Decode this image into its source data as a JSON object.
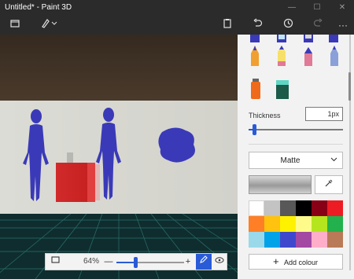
{
  "window": {
    "title": "Untitled* - Paint 3D",
    "minimize_glyph": "—",
    "maximize_glyph": "☐",
    "close_glyph": "✕"
  },
  "toolbar": {
    "menu_icon": "menu-folder-icon",
    "brushes_icon": "brushes-icon",
    "paste_icon": "paste-icon",
    "undo_icon": "undo-icon",
    "history_icon": "history-icon",
    "redo_icon": "redo-icon",
    "more_glyph": "···"
  },
  "zoom": {
    "percent": "64%",
    "level": 0.28,
    "minus": "—",
    "plus": "+"
  },
  "panel": {
    "thickness_label": "Thickness",
    "thickness_value": "1px",
    "thickness_level": 0.04,
    "finish": "Matte",
    "add_colour": "Add colour",
    "palette": [
      "#ffffff",
      "#c3c3c3",
      "#585858",
      "#000000",
      "#880015",
      "#ed1c24",
      "#ff7f27",
      "#ffc20e",
      "#fff200",
      "#fffb8b",
      "#b5e61d",
      "#22b14c",
      "#99d9ea",
      "#00a2e8",
      "#3f48cc",
      "#a349a4",
      "#ffaec9",
      "#b97a57"
    ]
  }
}
